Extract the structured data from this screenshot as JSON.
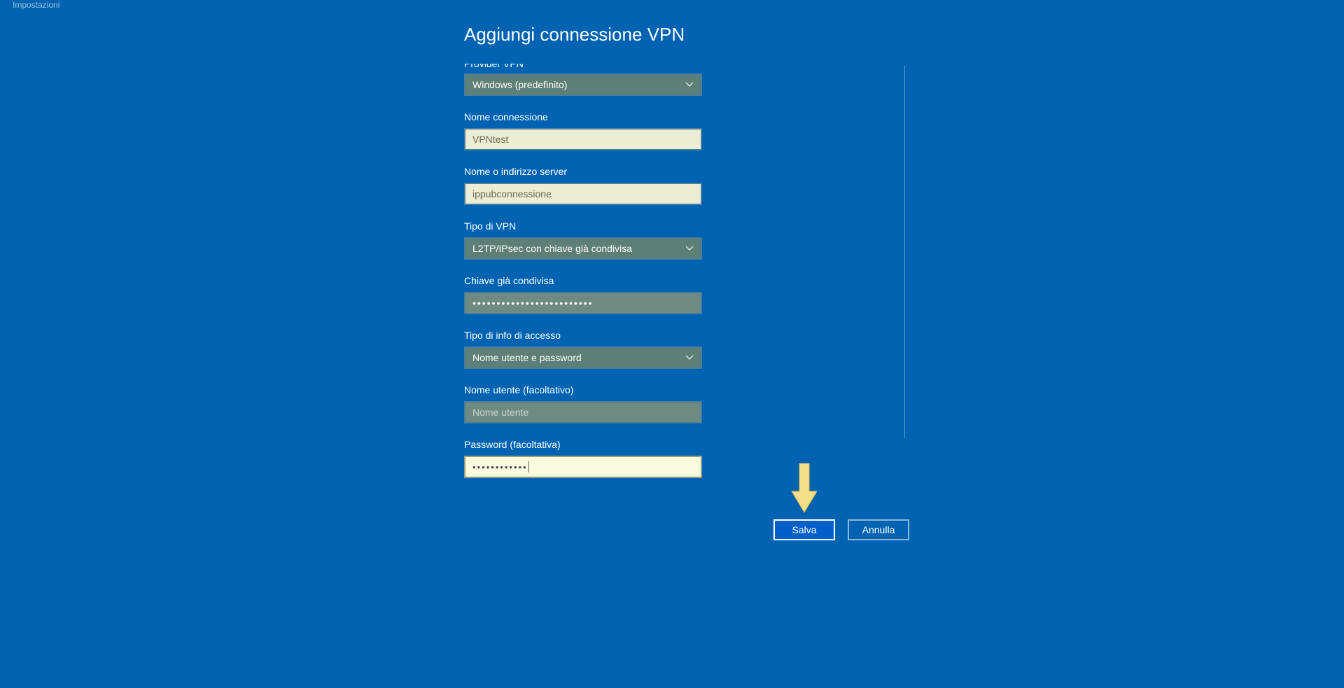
{
  "topbar_title": "Impostazioni",
  "form": {
    "title": "Aggiungi connessione VPN",
    "provider_label": "Provider VPN",
    "provider_value": "Windows (predefinito)",
    "connection_name_label": "Nome connessione",
    "connection_name_value": "VPNtest",
    "server_label": "Nome o indirizzo server",
    "server_value": "ippubconnessione",
    "vpn_type_label": "Tipo di VPN",
    "vpn_type_value": "L2TP/IPsec con chiave già condivisa",
    "psk_label": "Chiave già condivisa",
    "psk_masked": "•••••••••••••••••••••••••",
    "signin_type_label": "Tipo di info di accesso",
    "signin_type_value": "Nome utente e password",
    "username_label": "Nome utente (facoltativo)",
    "username_placeholder": "Nome utente",
    "password_label": "Password (facoltativa)",
    "password_masked": "••••••••••••"
  },
  "buttons": {
    "save": "Salva",
    "cancel": "Annulla"
  }
}
